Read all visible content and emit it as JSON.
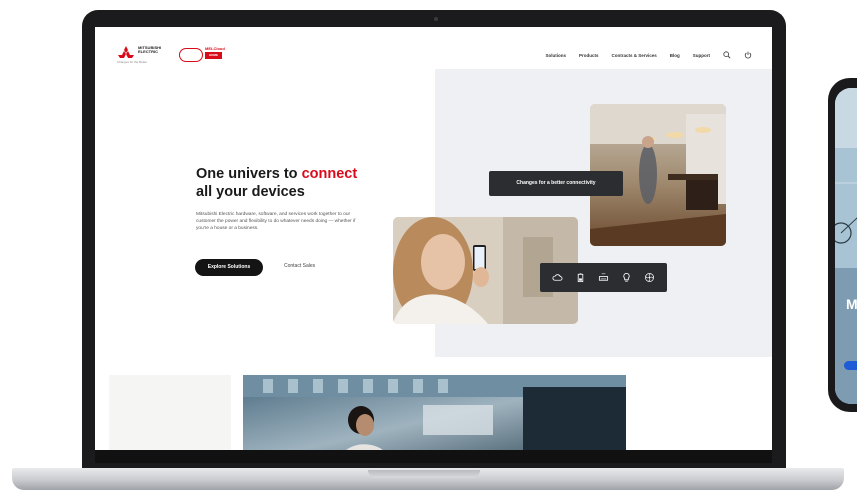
{
  "header": {
    "logo_mitsubishi_text": "MITSUBISHI ELECTRIC",
    "logo_mitsubishi_tagline": "Changes for the Better",
    "logo_melcloud_text": "MELCloud",
    "logo_melcloud_badge": "HOME",
    "nav": {
      "solutions": "Solutions",
      "products": "Products",
      "contracts": "Contracts & Services",
      "blog": "Blog",
      "support": "Support"
    },
    "icons": {
      "search": "search-icon",
      "account": "power-icon"
    }
  },
  "hero": {
    "title_part1": "One univers to ",
    "title_accent": "connect",
    "title_part2": "all your devices",
    "body": "Mitsubishi Electric hardware, software, and services work together to our customer the power and flexibility to do whatever needs doing — whether if you're a house or a business.",
    "primary_button": "Explore Solutions",
    "secondary_link": "Contact Sales",
    "image_tag": "Changes for a better connectivity",
    "strip_icons": [
      "cloud-icon",
      "battery-icon",
      "air-conditioner-icon",
      "lightbulb-icon",
      "fan-icon"
    ]
  },
  "phone": {
    "visible_letter": "M"
  },
  "colors": {
    "accent": "#d90b1a",
    "dark": "#141414",
    "panel": "#eef0f3"
  }
}
